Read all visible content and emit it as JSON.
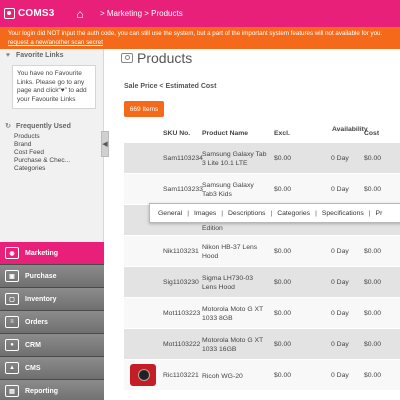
{
  "header": {
    "logo": "COMS3",
    "breadcrumb": "> Marketing > Products"
  },
  "warning": {
    "line1": "Your login did NOT input the auth code, you can still use the system, but a part of the important system features will not available for you.",
    "link": "request a new/another scan secret"
  },
  "sidebar": {
    "favorite_title": "Favorite Links",
    "favorite_text": "You have no Favourite Links. Please go to any page and click“♥” to add your Favourite Links",
    "frequent_title": "Frequently Used",
    "frequent_items": [
      "Products",
      "Brand",
      "Cost Feed",
      "Purchase & Chec...",
      "Categories"
    ],
    "collapse": "◀",
    "nav": [
      {
        "label": "Marketing"
      },
      {
        "label": "Purchase"
      },
      {
        "label": "Inventory"
      },
      {
        "label": "Orders"
      },
      {
        "label": "CRM"
      },
      {
        "label": "CMS"
      },
      {
        "label": "Reporting"
      }
    ]
  },
  "main": {
    "title": "Products",
    "filter": "Sale Price < Estimated Cost",
    "count": "669 Items",
    "columns": {
      "sku": "SKU No.",
      "product": "Product Name",
      "excl": "Excl.",
      "availability": "Availability",
      "cost": "Cost"
    },
    "rows": [
      {
        "sku": "Sam1103234",
        "product": "Samsung Galaxy Tab 3 Lite 10.1 LTE",
        "excl": "$0.00",
        "avail": "0 Day",
        "cost": "$0.00"
      },
      {
        "sku": "Sam1103233",
        "product": "Samsung Galaxy Tab3 Kids",
        "excl": "$0.00",
        "avail": "0 Day",
        "cost": "$0.00"
      },
      {
        "sku": "",
        "product": "Edition",
        "excl": "",
        "avail": "",
        "cost": ""
      },
      {
        "sku": "Nik1103231",
        "product": "Nikon HB-37 Lens Hood",
        "excl": "$0.00",
        "avail": "0 Day",
        "cost": "$0.00"
      },
      {
        "sku": "Sig1103230",
        "product": "Sigma LH730-03 Lens Hood",
        "excl": "$0.00",
        "avail": "0 Day",
        "cost": "$0.00"
      },
      {
        "sku": "Mot1103223",
        "product": "Motorola Moto G XT 1033 8GB",
        "excl": "$0.00",
        "avail": "0 Day",
        "cost": "$0.00"
      },
      {
        "sku": "Mot1103222",
        "product": "Motorola Moto G XT 1033 16GB",
        "excl": "$0.00",
        "avail": "0 Day",
        "cost": "$0.00"
      },
      {
        "sku": "Ric1103221",
        "product": "Ricoh WG-20",
        "excl": "$0.00",
        "avail": "0 Day",
        "cost": "$0.00"
      }
    ],
    "popup_tabs": [
      "General",
      "Images",
      "Descriptions",
      "Categories",
      "Specifications",
      "Pr"
    ]
  }
}
